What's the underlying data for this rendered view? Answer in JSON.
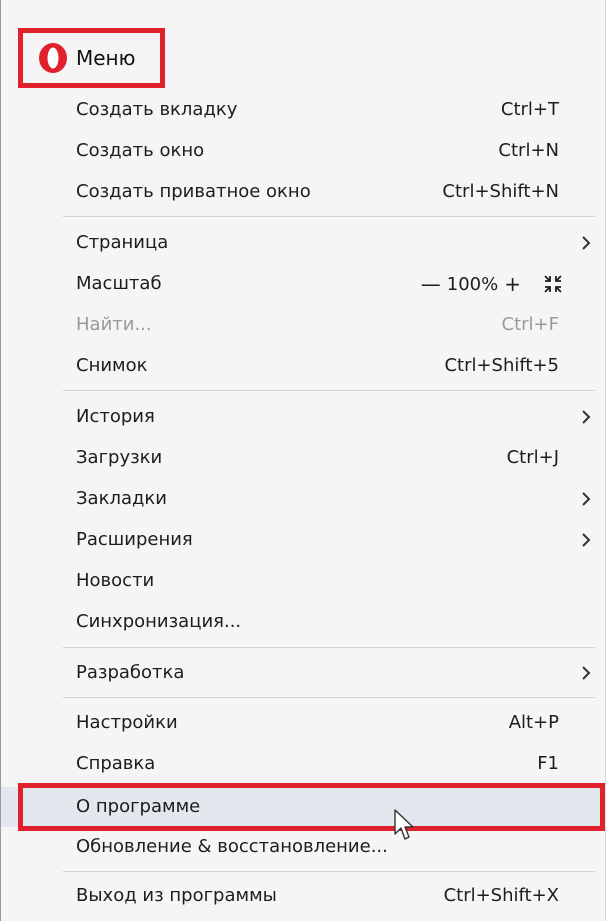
{
  "header": {
    "title": "Меню",
    "logo_icon": "opera-logo-icon"
  },
  "colors": {
    "highlight_border": "#e0202b",
    "hover_row": "#e3e7ee",
    "panel": "#f5f5f5",
    "disabled_text": "#9a9a9a"
  },
  "items": {
    "new_tab": {
      "label": "Создать вкладку",
      "shortcut": "Ctrl+T"
    },
    "new_window": {
      "label": "Создать окно",
      "shortcut": "Ctrl+N"
    },
    "new_private_window": {
      "label": "Создать приватное окно",
      "shortcut": "Ctrl+Shift+N"
    },
    "page": {
      "label": "Страница"
    },
    "zoom": {
      "label": "Масштаб",
      "minus": "—",
      "value": "100%",
      "plus": "+"
    },
    "find": {
      "label": "Найти...",
      "shortcut": "Ctrl+F",
      "disabled": true
    },
    "snapshot": {
      "label": "Снимок",
      "shortcut": "Ctrl+Shift+5"
    },
    "history": {
      "label": "История"
    },
    "downloads": {
      "label": "Загрузки",
      "shortcut": "Ctrl+J"
    },
    "bookmarks": {
      "label": "Закладки"
    },
    "extensions": {
      "label": "Расширения"
    },
    "news": {
      "label": "Новости"
    },
    "sync": {
      "label": "Синхронизация..."
    },
    "developer": {
      "label": "Разработка"
    },
    "settings": {
      "label": "Настройки",
      "shortcut": "Alt+P"
    },
    "help": {
      "label": "Справка",
      "shortcut": "F1"
    },
    "about": {
      "label": "О программе",
      "highlighted": true
    },
    "update": {
      "label": "Обновление & восстановление..."
    },
    "exit": {
      "label": "Выход из программы",
      "shortcut": "Ctrl+Shift+X"
    }
  }
}
